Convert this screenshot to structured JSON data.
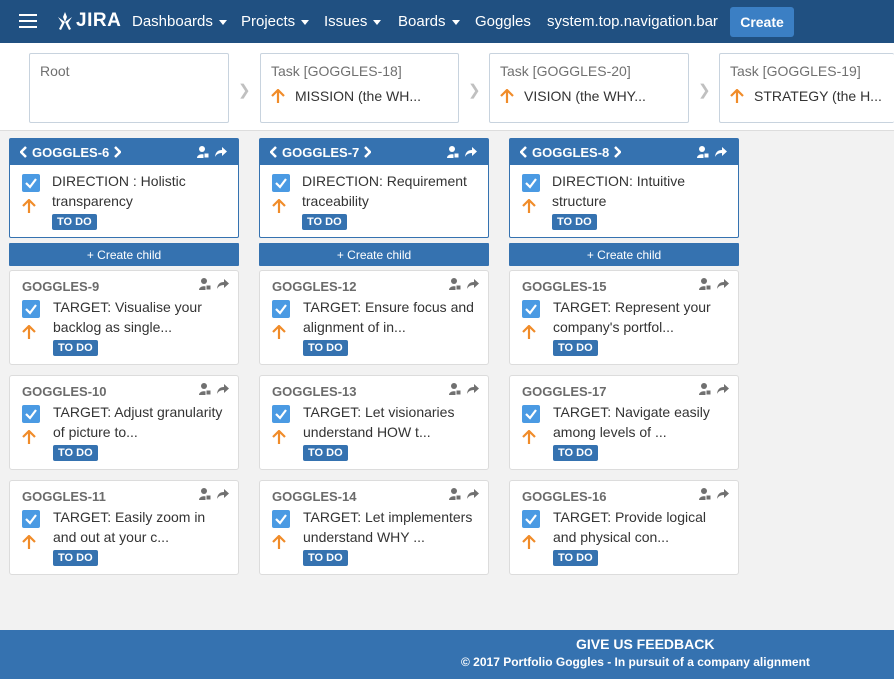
{
  "nav": {
    "logo": "JIRA",
    "items": [
      {
        "label": "Dashboards",
        "caret": true
      },
      {
        "label": "Projects",
        "caret": true
      },
      {
        "label": "Issues",
        "caret": true
      },
      {
        "label": "Boards",
        "caret": true
      },
      {
        "label": "Goggles",
        "caret": false
      },
      {
        "label": "system.top.navigation.bar",
        "caret": false
      }
    ],
    "create_label": "Create"
  },
  "breadcrumbs": [
    {
      "title": "Root",
      "summary": ""
    },
    {
      "title": "Task [GOGGLES-18]",
      "summary": "MISSION (the WH..."
    },
    {
      "title": "Task [GOGGLES-20]",
      "summary": "VISION (the WHY..."
    },
    {
      "title": "Task [GOGGLES-19]",
      "summary": "STRATEGY (the H..."
    }
  ],
  "columns": [
    {
      "parent": {
        "key": "GOGGLES-6",
        "summary": "DIRECTION : Holistic transparency",
        "status": "TO DO"
      },
      "create_child_label": "+ Create child",
      "children": [
        {
          "key": "GOGGLES-9",
          "summary": "TARGET: Visualise your backlog as single...",
          "status": "TO DO"
        },
        {
          "key": "GOGGLES-10",
          "summary": "TARGET: Adjust granularity of picture to...",
          "status": "TO DO"
        },
        {
          "key": "GOGGLES-11",
          "summary": "TARGET: Easily zoom in and out at your c...",
          "status": "TO DO"
        }
      ]
    },
    {
      "parent": {
        "key": "GOGGLES-7",
        "summary": "DIRECTION: Requirement traceability",
        "status": "TO DO"
      },
      "create_child_label": "+ Create child",
      "children": [
        {
          "key": "GOGGLES-12",
          "summary": "TARGET: Ensure focus and alignment of in...",
          "status": "TO DO"
        },
        {
          "key": "GOGGLES-13",
          "summary": "TARGET: Let visionaries understand HOW t...",
          "status": "TO DO"
        },
        {
          "key": "GOGGLES-14",
          "summary": "TARGET: Let implementers understand WHY ...",
          "status": "TO DO"
        }
      ]
    },
    {
      "parent": {
        "key": "GOGGLES-8",
        "summary": "DIRECTION: Intuitive structure",
        "status": "TO DO"
      },
      "create_child_label": "+ Create child",
      "children": [
        {
          "key": "GOGGLES-15",
          "summary": "TARGET: Represent your company's portfol...",
          "status": "TO DO"
        },
        {
          "key": "GOGGLES-17",
          "summary": "TARGET: Navigate easily among levels of ...",
          "status": "TO DO"
        },
        {
          "key": "GOGGLES-16",
          "summary": "TARGET: Provide logical and physical con...",
          "status": "TO DO"
        }
      ]
    }
  ],
  "footer": {
    "feedback": "GIVE US FEEDBACK",
    "copyright_prefix": "© 2017 ",
    "brand": "Portfolio Goggles",
    "tagline": " - In pursuit of a company alignment"
  },
  "colors": {
    "nav": "#205081",
    "accent": "#3572b0",
    "create": "#3b7fc4",
    "checkbox": "#4a9ae3",
    "priority": "#f08c2a"
  },
  "icons": [
    "menu-icon",
    "jira-logo-icon",
    "chevron-left-icon",
    "chevron-right-icon",
    "lock-user-icon",
    "share-arrow-icon",
    "checkbox-icon",
    "priority-up-arrow-icon"
  ]
}
